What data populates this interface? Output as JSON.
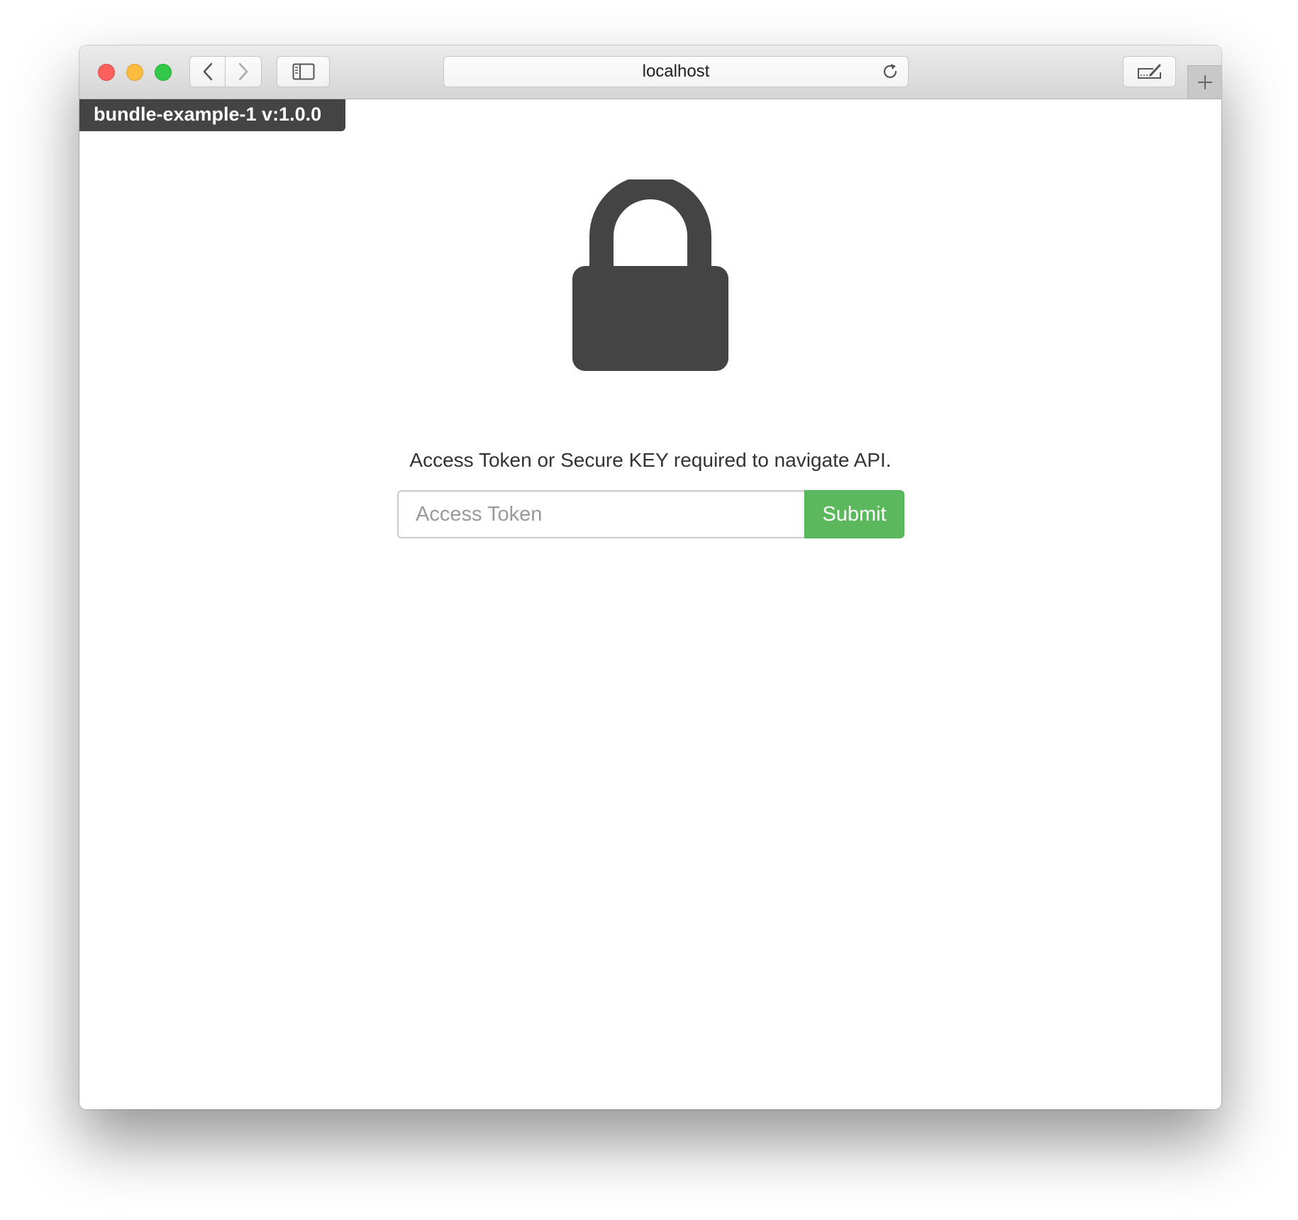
{
  "browser": {
    "address": "localhost",
    "icons": {
      "close": "close-window-button",
      "minimize": "minimize-window-button",
      "maximize": "maximize-window-button",
      "back": "chevron-left-icon",
      "forward": "chevron-right-icon",
      "sidebar": "sidebar-icon",
      "reload": "reload-icon",
      "share": "share-edit-icon",
      "new_tab": "plus-icon"
    },
    "colors": {
      "close": "#fc605c",
      "minimize": "#fdbc40",
      "maximize": "#34c84a"
    }
  },
  "page": {
    "version_badge": "bundle-example-1 v:1.0.0",
    "lock_icon": "lock-icon",
    "message": "Access Token or Secure KEY required to navigate API.",
    "token_input": {
      "placeholder": "Access Token",
      "value": ""
    },
    "submit_label": "Submit",
    "colors": {
      "submit": "#5cb85c",
      "lock": "#444444",
      "badge": "#444444"
    }
  }
}
